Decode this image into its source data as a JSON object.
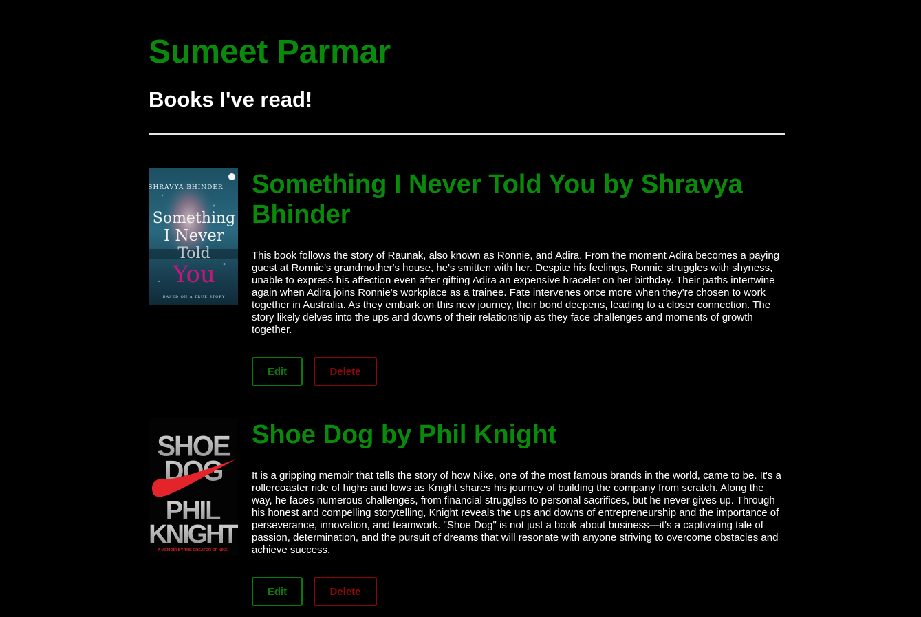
{
  "header": {
    "title": "Sumeet Parmar",
    "subtitle": "Books I've read!"
  },
  "books": [
    {
      "title": "Something I Never Told You by Shravya Bhinder",
      "description": "This book follows the story of Raunak, also known as Ronnie, and Adira. From the moment Adira becomes a paying guest at Ronnie's grandmother's house, he's smitten with her. Despite his feelings, Ronnie struggles with shyness, unable to express his affection even after gifting Adira an expensive bracelet on her birthday. Their paths intertwine again when Adira joins Ronnie's workplace as a trainee. Fate intervenes once more when they're chosen to work together in Australia. As they embark on this new journey, their bond deepens, leading to a closer connection. The story likely delves into the ups and downs of their relationship as they face challenges and moments of growth together.",
      "edit_label": "Edit",
      "delete_label": "Delete",
      "cover": {
        "author": "SHRAVYA BHINDER",
        "line1": "Something",
        "line2": "I Never",
        "line3": "Told",
        "line4": "You",
        "tagline": "BASED ON A TRUE STORY"
      }
    },
    {
      "title": "Shoe Dog by Phil Knight",
      "description": "It is a gripping memoir that tells the story of how Nike, one of the most famous brands in the world, came to be. It's a rollercoaster ride of highs and lows as Knight shares his journey of building the company from scratch. Along the way, he faces numerous challenges, from financial struggles to personal sacrifices, but he never gives up. Through his honest and compelling storytelling, Knight reveals the ups and downs of entrepreneurship and the importance of perseverance, innovation, and teamwork. \"Shoe Dog\" is not just a book about business—it's a captivating tale of passion, determination, and the pursuit of dreams that will resonate with anyone striving to overcome obstacles and achieve success.",
      "edit_label": "Edit",
      "delete_label": "Delete",
      "cover": {
        "title1": "SHOE",
        "title2": "DOG",
        "author1": "PHIL",
        "author2": "KNIGHT",
        "tagline": "A MEMOIR BY THE CREATOR OF NIKE"
      }
    }
  ],
  "colors": {
    "background": "#000000",
    "accent_green": "#0a8a0a",
    "delete_red": "#8a0a0a",
    "text": "#ffffff"
  }
}
